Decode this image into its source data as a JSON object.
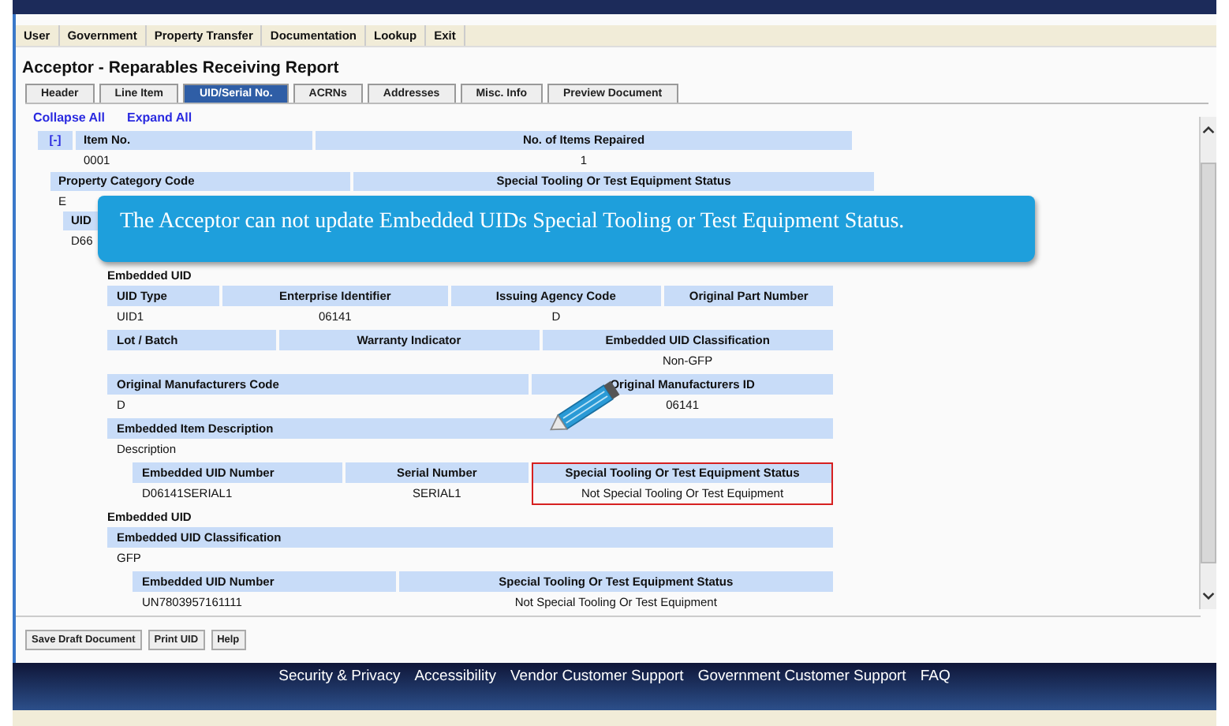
{
  "menu": [
    "User",
    "Government",
    "Property Transfer",
    "Documentation",
    "Lookup",
    "Exit"
  ],
  "page_title": "Acceptor - Reparables Receiving Report",
  "tabs": [
    {
      "label": "Header",
      "selected": false
    },
    {
      "label": "Line Item",
      "selected": false
    },
    {
      "label": "UID/Serial No.",
      "selected": true
    },
    {
      "label": "ACRNs",
      "selected": false
    },
    {
      "label": "Addresses",
      "selected": false
    },
    {
      "label": "Misc. Info",
      "selected": false
    },
    {
      "label": "Preview Document",
      "selected": false
    }
  ],
  "links": [
    "Collapse All",
    "Expand All"
  ],
  "item": {
    "toggle": "[-]",
    "columns": [
      "Item No.",
      "No. of Items Repaired"
    ],
    "values": [
      "0001",
      "1"
    ]
  },
  "property": {
    "columns": [
      "Property Category Code",
      "Special Tooling Or Test Equipment Status"
    ],
    "value": "E"
  },
  "uid": {
    "header": "UID",
    "value": "D66"
  },
  "callout": "The Acceptor can not update Embedded UIDs Special Tooling or Test Equipment Status.",
  "blocks": [
    {
      "kind": "label",
      "text": "Embedded UID"
    },
    {
      "kind": "table",
      "columns": [
        {
          "label": "UID Type",
          "value": "UID1",
          "highlighted": false
        },
        {
          "label": "Enterprise Identifier",
          "value": "06141",
          "highlighted": false
        },
        {
          "label": "Issuing Agency Code",
          "value": "D",
          "highlighted": false
        },
        {
          "label": "Original Part Number",
          "highlighted": false
        }
      ]
    },
    {
      "kind": "table",
      "columns": [
        {
          "label": "Lot / Batch",
          "highlighted": false
        },
        {
          "label": "Warranty Indicator",
          "highlighted": false
        },
        {
          "label": "Embedded UID Classification",
          "value": "Non-GFP",
          "highlighted": false
        }
      ]
    },
    {
      "kind": "table",
      "columns": [
        {
          "label": "Original Manufacturers Code",
          "value": "D",
          "highlighted": false
        },
        {
          "label": "Original Manufacturers ID",
          "value": "06141",
          "highlighted": false
        }
      ]
    },
    {
      "kind": "table",
      "columns": [
        {
          "label": "Embedded Item Description",
          "value": "Description",
          "highlighted": false
        }
      ]
    },
    {
      "kind": "subtable",
      "columns": [
        {
          "label": "Embedded UID Number",
          "value": "D06141SERIAL1",
          "highlighted": false
        },
        {
          "label": "Serial Number",
          "value": "SERIAL1",
          "highlighted": false
        },
        {
          "label": "Special Tooling Or Test Equipment Status",
          "value": "Not Special Tooling Or Test Equipment",
          "highlighted": true
        }
      ]
    },
    {
      "kind": "label",
      "text": "Embedded UID"
    },
    {
      "kind": "table",
      "columns": [
        {
          "label": "Embedded UID Classification",
          "value": "GFP",
          "highlighted": false
        }
      ]
    },
    {
      "kind": "subtable",
      "columns": [
        {
          "label": "Embedded UID Number",
          "value": "UN7803957161111",
          "highlighted": false
        },
        {
          "label": "Special Tooling Or Test Equipment Status",
          "value": "Not Special Tooling Or Test Equipment",
          "highlighted": false
        }
      ]
    }
  ],
  "buttons": [
    "Save Draft Document",
    "Print UID",
    "Help"
  ],
  "footer_links": [
    "Security & Privacy",
    "Accessibility",
    "Vendor Customer Support",
    "Government Customer Support",
    "FAQ"
  ]
}
